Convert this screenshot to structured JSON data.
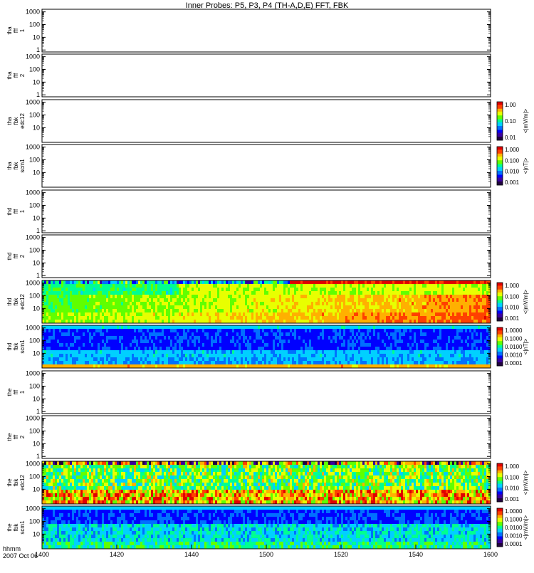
{
  "chart_data": {
    "type": "heatmap",
    "title": "Inner Probes: P5, P3, P4 (TH-A,D,E) FFT, FBK",
    "xaxis": {
      "label": "hhmm",
      "date": "2007 Oct 06",
      "ticks": [
        "1400",
        "1420",
        "1440",
        "1500",
        "1520",
        "1540",
        "1600"
      ],
      "range": [
        "1400",
        "1600"
      ]
    },
    "panels": [
      {
        "probe": "tha",
        "label": [
          "tha",
          "fff",
          "1"
        ],
        "yticks": [
          "1",
          "10",
          "100",
          "1000"
        ],
        "yscale": "log",
        "ylim": [
          1,
          1000
        ],
        "has_data": false,
        "colorbar": null
      },
      {
        "probe": "tha",
        "label": [
          "tha",
          "fff",
          "2"
        ],
        "yticks": [
          "1",
          "10",
          "100",
          "1000"
        ],
        "yscale": "log",
        "ylim": [
          1,
          1000
        ],
        "has_data": false,
        "colorbar": null
      },
      {
        "probe": "tha",
        "label": [
          "tha",
          "fbk",
          "edc12"
        ],
        "yticks": [
          "10",
          "100",
          "1000"
        ],
        "yscale": "log",
        "has_data": false,
        "colorbar": {
          "label": "<|mV/m|>",
          "ticks": [
            "1.00",
            "0.10",
            "0.01"
          ],
          "scale": "log"
        }
      },
      {
        "probe": "tha",
        "label": [
          "tha",
          "fbk",
          "scm1"
        ],
        "yticks": [
          "10",
          "100",
          "1000"
        ],
        "yscale": "log",
        "has_data": false,
        "colorbar": {
          "label": "<|nT|>",
          "ticks": [
            "1.000",
            "0.100",
            "0.010",
            "0.001"
          ],
          "scale": "log"
        }
      },
      {
        "probe": "thd",
        "label": [
          "thd",
          "fff",
          "1"
        ],
        "yticks": [
          "1",
          "10",
          "100",
          "1000"
        ],
        "yscale": "log",
        "ylim": [
          1,
          1000
        ],
        "has_data": false,
        "colorbar": null
      },
      {
        "probe": "thd",
        "label": [
          "thd",
          "fff",
          "2"
        ],
        "yticks": [
          "1",
          "10",
          "100",
          "1000"
        ],
        "yscale": "log",
        "ylim": [
          1,
          1000
        ],
        "has_data": false,
        "colorbar": null
      },
      {
        "probe": "thd",
        "label": [
          "thd",
          "fbk",
          "edc12"
        ],
        "yticks": [
          "10",
          "100",
          "1000"
        ],
        "yscale": "log",
        "has_data": true,
        "pattern": "edc-d",
        "colorbar": {
          "label": "<|mV/m|>",
          "ticks": [
            "1.000",
            "0.100",
            "0.010",
            "0.001"
          ],
          "scale": "log"
        }
      },
      {
        "probe": "thd",
        "label": [
          "thd",
          "fbk",
          "scm1"
        ],
        "yticks": [
          "10",
          "100",
          "1000"
        ],
        "yscale": "log",
        "has_data": true,
        "pattern": "scm",
        "colorbar": {
          "label": "<|nT|>",
          "ticks": [
            "1.0000",
            "0.1000",
            "0.0100",
            "0.0010",
            "0.0001"
          ],
          "scale": "log"
        }
      },
      {
        "probe": "the",
        "label": [
          "the",
          "fff",
          "1"
        ],
        "yticks": [
          "1",
          "10",
          "100",
          "1000"
        ],
        "yscale": "log",
        "ylim": [
          1,
          1000
        ],
        "has_data": false,
        "colorbar": null
      },
      {
        "probe": "the",
        "label": [
          "the",
          "fff",
          "2"
        ],
        "yticks": [
          "1",
          "10",
          "100",
          "1000"
        ],
        "yscale": "log",
        "ylim": [
          1,
          1000
        ],
        "has_data": false,
        "colorbar": null
      },
      {
        "probe": "the",
        "label": [
          "the",
          "fbk",
          "edc12"
        ],
        "yticks": [
          "10",
          "100",
          "1000"
        ],
        "yscale": "log",
        "has_data": true,
        "pattern": "edc-e",
        "colorbar": {
          "label": "<|mV/m|>",
          "ticks": [
            "1.000",
            "0.100",
            "0.010",
            "0.001"
          ],
          "scale": "log"
        }
      },
      {
        "probe": "the",
        "label": [
          "the",
          "fbk",
          "scm1"
        ],
        "yticks": [
          "10",
          "100",
          "1000"
        ],
        "yscale": "log",
        "has_data": true,
        "pattern": "scm-e",
        "colorbar": {
          "label": "<|mV/m|>",
          "ticks": [
            "1.0000",
            "0.1000",
            "0.0100",
            "0.0010",
            "0.0001"
          ],
          "scale": "log"
        }
      }
    ],
    "colormap": [
      "#200040",
      "#3a00a0",
      "#0000ff",
      "#0070ff",
      "#00d0ff",
      "#00ff90",
      "#60ff00",
      "#e8ff00",
      "#ffb000",
      "#ff4000",
      "#e00000"
    ]
  }
}
